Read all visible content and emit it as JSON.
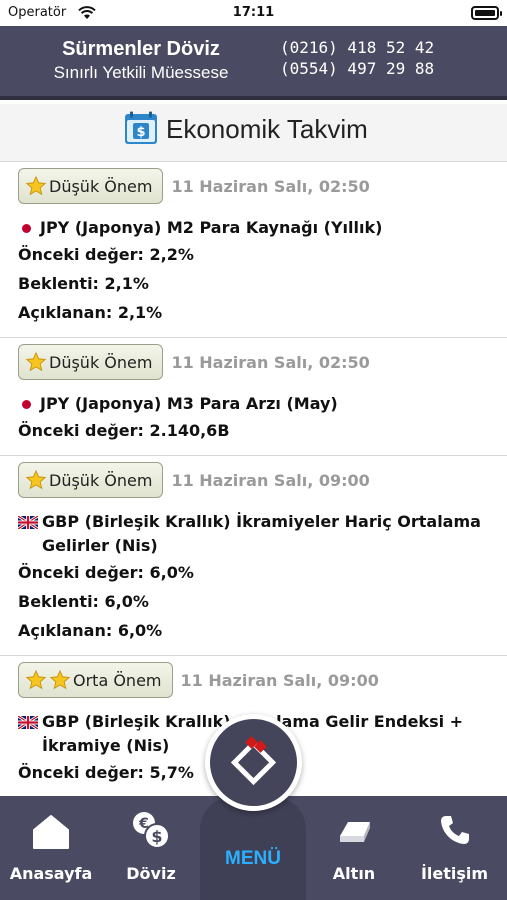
{
  "status": {
    "carrier": "Operatör",
    "time": "17:11"
  },
  "header": {
    "name": "Sürmenler Döviz",
    "subtitle": "Sınırlı Yetkili Müessese",
    "phone1": "(0216) 418 52 42",
    "phone2": "(0554) 497 29 88"
  },
  "page": {
    "title": "Ekonomik Takvim",
    "icon": "calendar-dollar-icon"
  },
  "events": [
    {
      "importance": "Düşük Önem",
      "stars": 1,
      "date": "11 Haziran Salı, 02:50",
      "flag": "japan-flag-icon",
      "title": "JPY (Japonya) M2 Para Kaynağı (Yıllık)",
      "previous": "Önceki değer: 2,2%",
      "forecast": "Beklenti: 2,1%",
      "actual": "Açıklanan: 2,1%"
    },
    {
      "importance": "Düşük Önem",
      "stars": 1,
      "date": "11 Haziran Salı, 02:50",
      "flag": "japan-flag-icon",
      "title": "JPY (Japonya) M3 Para Arzı (May)",
      "previous": "Önceki değer: 2.140,6B"
    },
    {
      "importance": "Düşük Önem",
      "stars": 1,
      "date": "11 Haziran Salı, 09:00",
      "flag": "uk-flag-icon",
      "title": "GBP (Birleşik Krallık) İkramiyeler Hariç Ortalama Gelirler (Nis)",
      "previous": "Önceki değer: 6,0%",
      "forecast": "Beklenti: 6,0%",
      "actual": "Açıklanan: 6,0%"
    },
    {
      "importance": "Orta Önem",
      "stars": 2,
      "date": "11 Haziran Salı, 09:00",
      "flag": "uk-flag-icon",
      "title": "GBP (Birleşik Krallık) Ortalama Gelir Endeksi + İkramiye (Nis)",
      "previous": "Önceki değer: 5,7%"
    }
  ],
  "nav": {
    "home": "Anasayfa",
    "currency": "Döviz",
    "menu": "MENÜ",
    "gold": "Altın",
    "contact": "İletişim"
  },
  "colors": {
    "header_bg": "#4a4a62",
    "menu_accent": "#2ab0ff"
  }
}
